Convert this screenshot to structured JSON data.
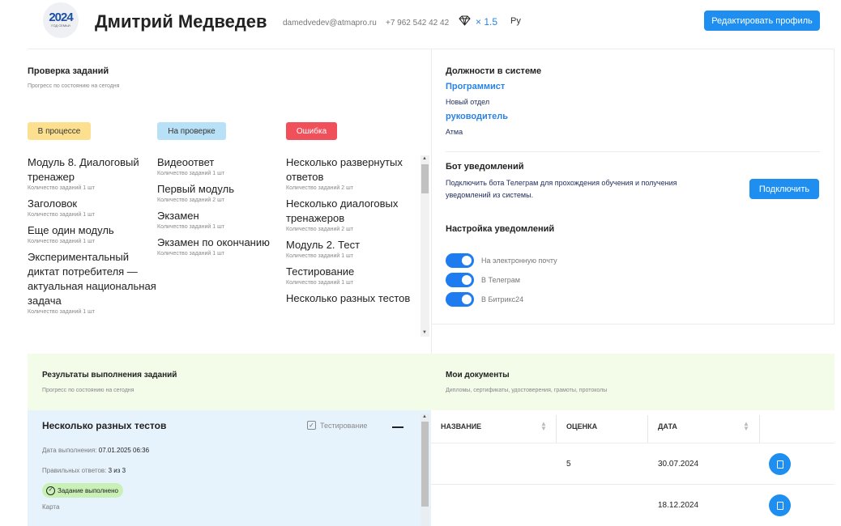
{
  "header": {
    "logo_year": "2024",
    "logo_subtitle": "ГОД СЕМЬИ",
    "user_name": "Дмитрий Медведев",
    "email": "damedvedev@atmapro.ru",
    "phone": "+7 962 542 42 42",
    "diamond_icon": "diamond-icon",
    "multiplier": "× 1.5",
    "language": "Ру",
    "edit_button": "Редактировать профиль"
  },
  "tasks": {
    "title": "Проверка заданий",
    "subtitle": "Прогресс по состоянию на сегодня",
    "columns": [
      {
        "status": "В процессе",
        "color": "#fce08f",
        "items": [
          {
            "title": "Модуль 8. Диалоговый тренажер",
            "count": "Количество заданий 1 шт"
          },
          {
            "title": "Заголовок",
            "count": "Количество заданий 1 шт"
          },
          {
            "title": "Еще один модуль",
            "count": "Количество заданий 1 шт"
          },
          {
            "title": "Экспериментальный диктат потребителя — актуальная национальная задача",
            "count": "Количество заданий 1 шт"
          }
        ]
      },
      {
        "status": "На проверке",
        "color": "#b8e1f7",
        "items": [
          {
            "title": "Видеоответ",
            "count": "Количество заданий 1 шт"
          },
          {
            "title": "Первый модуль",
            "count": "Количество заданий 2 шт"
          },
          {
            "title": "Экзамен",
            "count": "Количество заданий 1 шт"
          },
          {
            "title": "Экзамен по окончанию",
            "count": "Количество заданий 1 шт"
          }
        ]
      },
      {
        "status": "Ошибка",
        "color": "#f0505a",
        "items": [
          {
            "title": "Несколько развернутых ответов",
            "count": "Количество заданий 2 шт"
          },
          {
            "title": "Несколько диалоговых тренажеров",
            "count": "Количество заданий 2 шт"
          },
          {
            "title": "Модуль 2. Тест",
            "count": "Количество заданий 1 шт"
          },
          {
            "title": "Тестирование",
            "count": "Количество заданий 1 шт"
          },
          {
            "title": "Несколько разных тестов",
            "count": ""
          }
        ]
      }
    ]
  },
  "positions": {
    "title": "Должности в системе",
    "roles": [
      {
        "role": "Программист",
        "dept": "Новый отдел"
      },
      {
        "role": "руководитель",
        "dept": "Атма"
      }
    ]
  },
  "bot": {
    "title": "Бот уведомлений",
    "text": "Подключить бота Телеграм для прохождения обучения и получения уведомлений из системы.",
    "connect_button": "Подключить"
  },
  "notifications": {
    "title": "Настройка уведомлений",
    "toggles": [
      {
        "label": "На электронную почту",
        "on": true
      },
      {
        "label": "В Телеграм",
        "on": true
      },
      {
        "label": "В Битрикс24",
        "on": true
      }
    ]
  },
  "results": {
    "title": "Результаты выполнения заданий",
    "subtitle": "Прогресс по состоянию на сегодня",
    "card": {
      "title": "Несколько разных тестов",
      "type": "Тестирование",
      "date_label": "Дата выполнения:",
      "date_value": "07.01.2025 06:36",
      "correct_label": "Правильных ответов:",
      "correct_value": "3 из 3",
      "status": "Задание выполнено",
      "extra": "Карта"
    }
  },
  "documents": {
    "title": "Мои документы",
    "subtitle": "Дипломы, сертификаты, удостоверения, грамоты, протоколы",
    "columns": [
      "НАЗВАНИЕ",
      "ОЦЕНКА",
      "ДАТА"
    ],
    "rows": [
      {
        "name": "",
        "grade": "5",
        "date": "30.07.2024"
      },
      {
        "name": "",
        "grade": "",
        "date": "18.12.2024"
      }
    ]
  },
  "colors": {
    "accent": "#1e8ff0",
    "link": "#2a83e5",
    "green_band": "#f3fbe9",
    "card_blue": "#e6f3fd"
  }
}
